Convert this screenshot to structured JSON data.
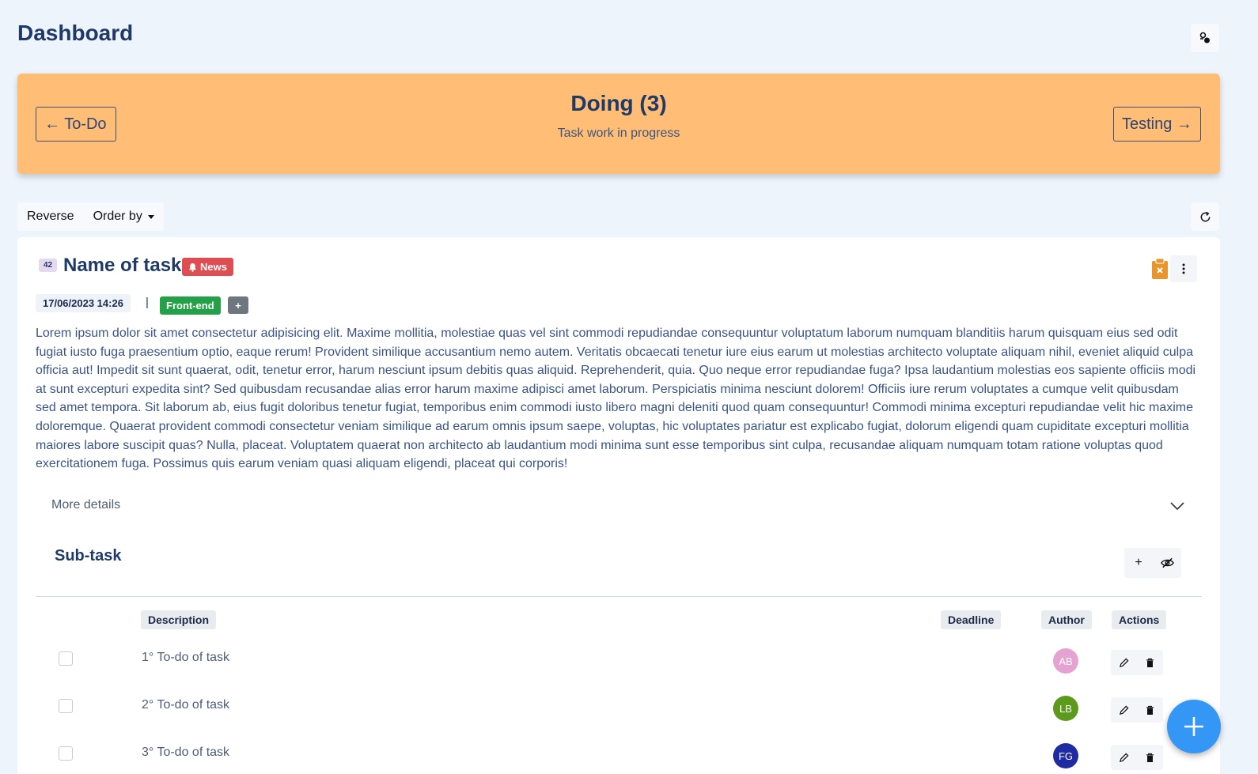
{
  "page": {
    "title": "Dashboard"
  },
  "banner": {
    "title": "Doing (3)",
    "subtitle": "Task work in progress",
    "prev_label": "← To-Do",
    "next_label": "Testing →",
    "color": "#ffbd76"
  },
  "toolbar": {
    "reverse_label": "Reverse",
    "order_label": "Order by"
  },
  "task": {
    "id": "42",
    "name": "Name of task",
    "badge": "News",
    "date": "17/06/2023 14:26",
    "separator": "|",
    "tag": "Front-end",
    "add_tag_label": "+",
    "description": "Lorem ipsum dolor sit amet consectetur adipisicing elit. Maxime mollitia, molestiae quas vel sint commodi repudiandae consequuntur voluptatum laborum numquam blanditiis harum quisquam eius sed odit fugiat iusto fuga praesentium optio, eaque rerum! Provident similique accusantium nemo autem. Veritatis obcaecati tenetur iure eius earum ut molestias architecto voluptate aliquam nihil, eveniet aliquid culpa officia aut! Impedit sit sunt quaerat, odit, tenetur error, harum nesciunt ipsum debitis quas aliquid. Reprehenderit, quia. Quo neque error repudiandae fuga? Ipsa laudantium molestias eos sapiente officiis modi at sunt excepturi expedita sint? Sed quibusdam recusandae alias error harum maxime adipisci amet laborum. Perspiciatis minima nesciunt dolorem! Officiis iure rerum voluptates a cumque velit quibusdam sed amet tempora. Sit laborum ab, eius fugit doloribus tenetur fugiat, temporibus enim commodi iusto libero magni deleniti quod quam consequuntur! Commodi minima excepturi repudiandae velit hic maxime doloremque. Quaerat provident commodi consectetur veniam similique ad earum omnis ipsum saepe, voluptas, hic voluptates pariatur est explicabo fugiat, dolorum eligendi quam cupiditate excepturi mollitia maiores labore suscipit quas? Nulla, placeat. Voluptatem quaerat non architecto ab laudantium modi minima sunt esse temporibus sint culpa, recusandae aliquam numquam totam ratione voluptas quod exercitationem fuga. Possimus quis earum veniam quasi aliquam eligendi, placeat qui corporis!",
    "more_details_label": "More details"
  },
  "subtask": {
    "title": "Sub-task",
    "add_label": "+",
    "columns": {
      "description": "Description",
      "deadline": "Deadline",
      "author": "Author",
      "actions": "Actions"
    },
    "rows": [
      {
        "description": "1° To-do of task",
        "deadline": "",
        "author_initials": "AB",
        "author_color": "#e5a3d2"
      },
      {
        "description": "2° To-do of task",
        "deadline": "",
        "author_initials": "LB",
        "author_color": "#5c9a1b"
      },
      {
        "description": "3° To-do of task",
        "deadline": "",
        "author_initials": "FG",
        "author_color": "#1f2ba1"
      }
    ]
  },
  "colors": {
    "background": "#eef4fc",
    "news_badge": "#de4d52",
    "tag": "#24a148",
    "fab": "#3497f5"
  }
}
